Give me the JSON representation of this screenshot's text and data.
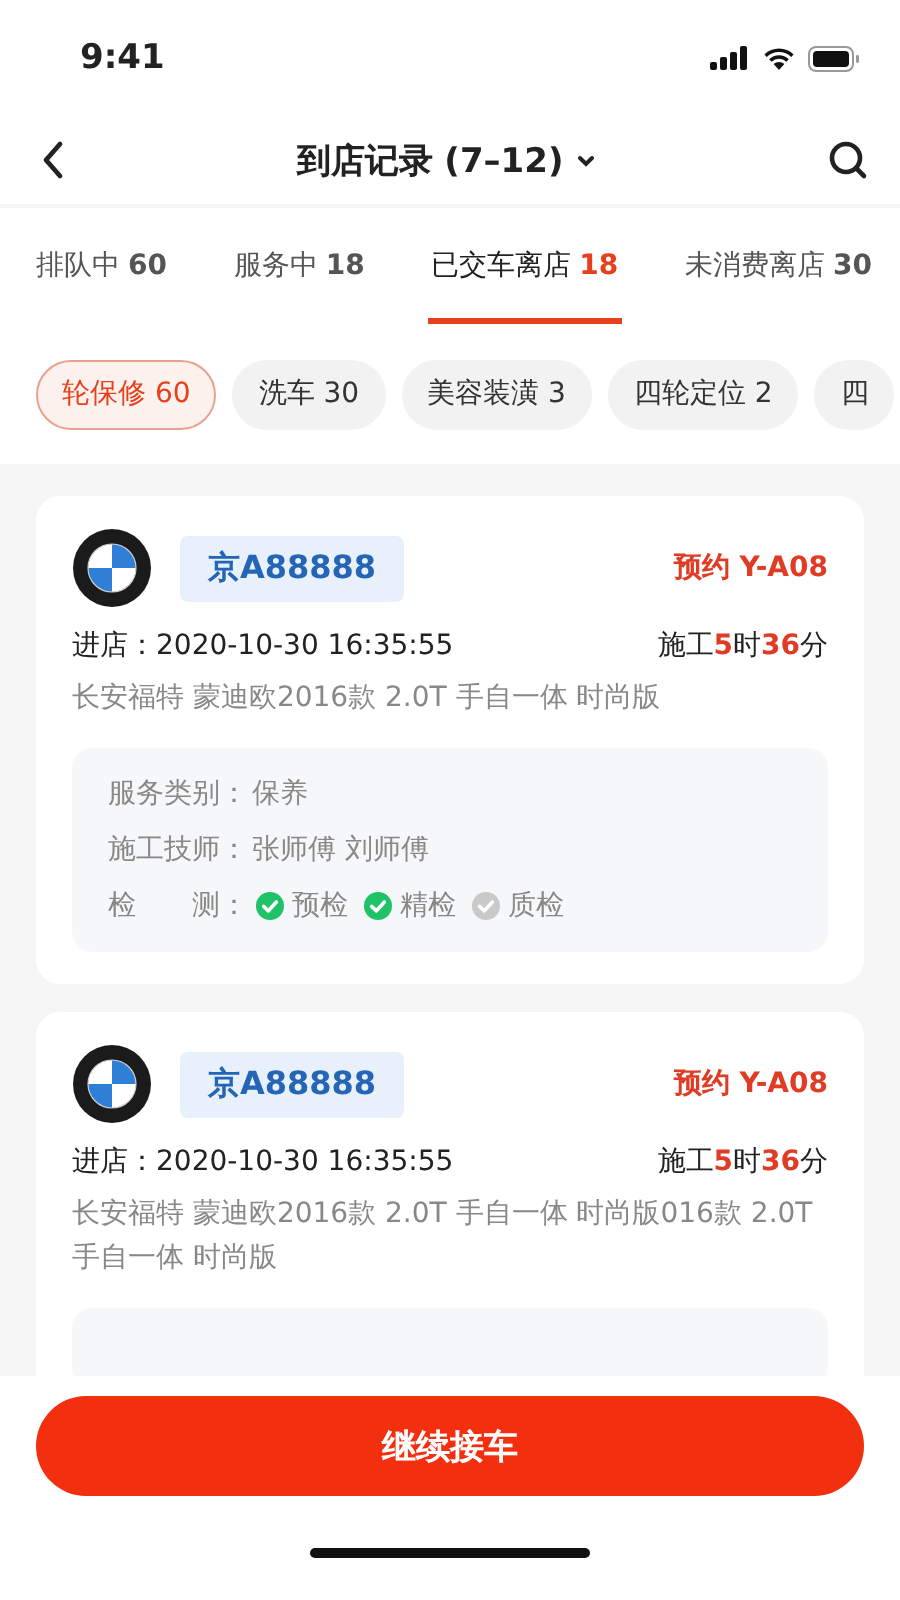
{
  "status_bar": {
    "time": "9:41"
  },
  "nav": {
    "title": "到店记录 (7–12)"
  },
  "tabs": [
    {
      "label": "排队中",
      "count": "60",
      "selected": false
    },
    {
      "label": "服务中",
      "count": "18",
      "selected": false
    },
    {
      "label": "已交车离店",
      "count": "18",
      "selected": true
    },
    {
      "label": "未消费离店",
      "count": "30",
      "selected": false
    }
  ],
  "filters": [
    {
      "label": "轮保修 60",
      "selected": true
    },
    {
      "label": "洗车 30",
      "selected": false
    },
    {
      "label": "美容装潢 3",
      "selected": false
    },
    {
      "label": "四轮定位 2",
      "selected": false
    },
    {
      "label": "四",
      "selected": false
    }
  ],
  "cards": [
    {
      "kind": "full",
      "plate": "京A88888",
      "reservation": "预约 Y-A08",
      "entry": "进店：2020-10-30 16:35:55",
      "duration": {
        "prefix": "施工",
        "hours": "5",
        "hours_unit": "时",
        "minutes": "36",
        "minutes_unit": "分"
      },
      "vehicle": "长安福特 蒙迪欧2016款 2.0T 手自一体 时尚版",
      "details": {
        "service": {
          "label": "服务类别：",
          "value": "保养"
        },
        "technicians": {
          "label": "施工技师：",
          "value": "张师傅 刘师傅"
        },
        "checks_label": "检　　测：",
        "checks": [
          {
            "label": "预检",
            "done": true
          },
          {
            "label": "精检",
            "done": true
          },
          {
            "label": "质检",
            "done": false
          }
        ]
      }
    },
    {
      "kind": "partial",
      "plate": "京A88888",
      "reservation": "预约 Y-A08",
      "entry": "进店：2020-10-30 16:35:55",
      "duration": {
        "prefix": "施工",
        "hours": "5",
        "hours_unit": "时",
        "minutes": "36",
        "minutes_unit": "分"
      },
      "vehicle": "长安福特 蒙迪欧2016款 2.0T 手自一体 时尚版016款 2.0T 手自一体 时尚版"
    }
  ],
  "action": {
    "label": "继续接车"
  }
}
